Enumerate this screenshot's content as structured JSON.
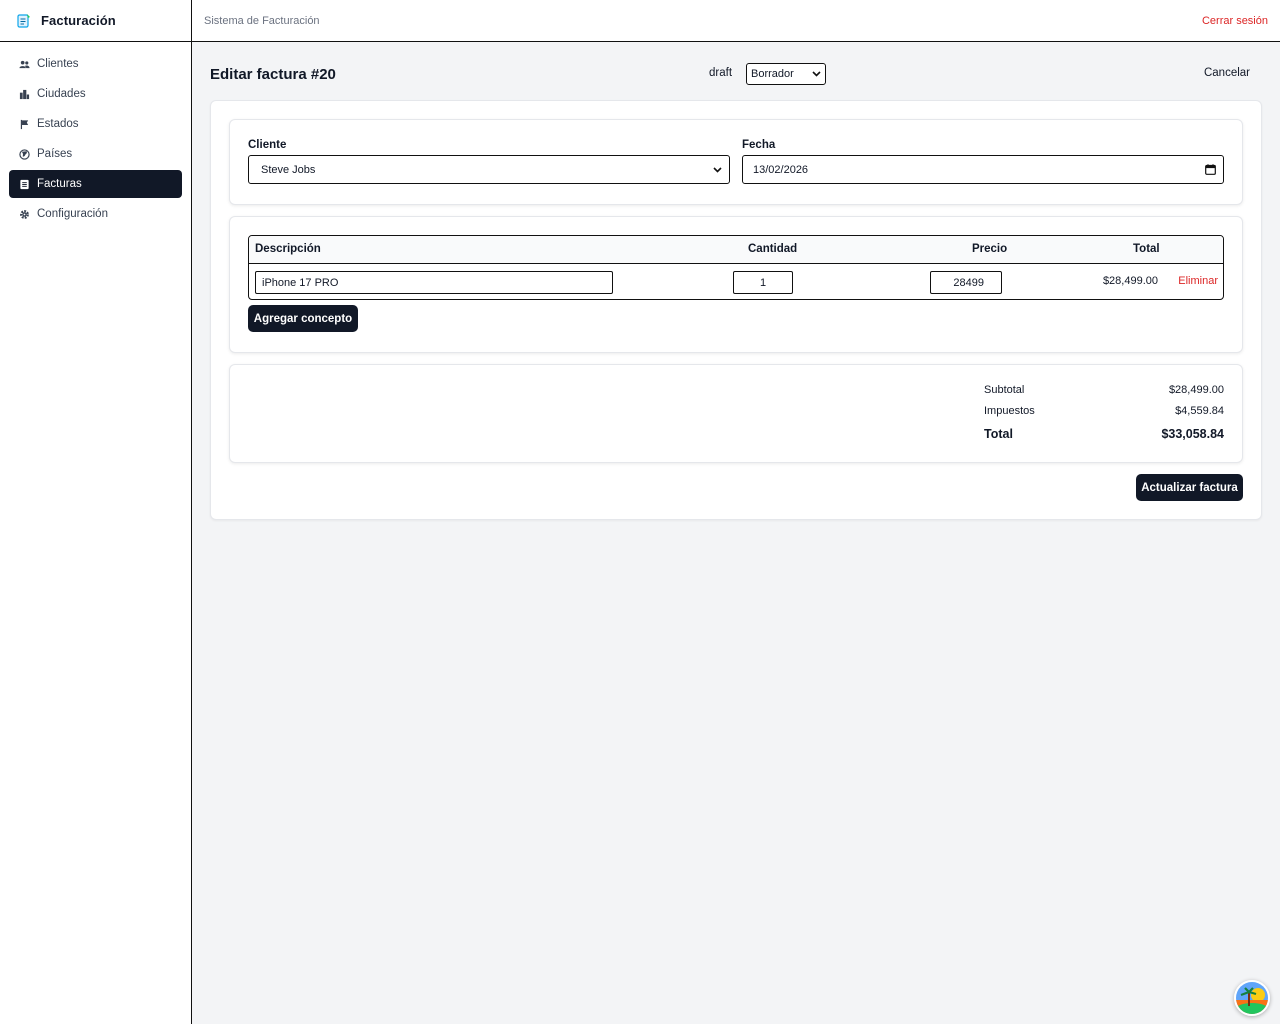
{
  "app": {
    "title": "Facturación"
  },
  "sidebar": {
    "items": [
      {
        "label": "Clientes",
        "icon": "users-icon"
      },
      {
        "label": "Ciudades",
        "icon": "buildings-icon"
      },
      {
        "label": "Estados",
        "icon": "flag-icon"
      },
      {
        "label": "Países",
        "icon": "globe-icon"
      },
      {
        "label": "Facturas",
        "icon": "invoice-icon",
        "active": true
      },
      {
        "label": "Configuración",
        "icon": "gear-icon"
      }
    ]
  },
  "topbar": {
    "system_name": "Sistema de Facturación",
    "logout_label": "Cerrar sesión"
  },
  "page": {
    "title": "Editar factura #20",
    "status_text": "draft",
    "status_select": "Borrador",
    "cancel_label": "Cancelar"
  },
  "form": {
    "client_label": "Cliente",
    "client_value": "Steve Jobs",
    "date_label": "Fecha",
    "date_value": "13/02/2026"
  },
  "items": {
    "headers": {
      "description": "Descripción",
      "quantity": "Cantidad",
      "price": "Precio",
      "total": "Total"
    },
    "rows": [
      {
        "description": "iPhone 17 PRO",
        "quantity": "1",
        "price": "28499",
        "total": "$28,499.00",
        "remove_label": "Eliminar"
      }
    ],
    "add_label": "Agregar concepto"
  },
  "summary": {
    "subtotal_label": "Subtotal",
    "subtotal": "$28,499.00",
    "tax_label": "Impuestos",
    "tax": "$4,559.84",
    "total_label": "Total",
    "total": "$33,058.84"
  },
  "actions": {
    "update_label": "Actualizar factura"
  },
  "colors": {
    "dark": "#111827",
    "danger": "#dc2626",
    "background": "#f3f4f6"
  }
}
